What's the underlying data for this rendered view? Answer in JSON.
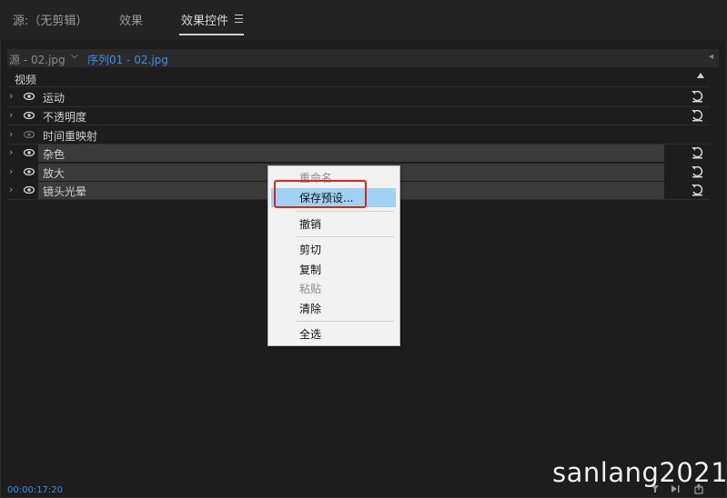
{
  "tabs": [
    {
      "label": "源:（无剪辑）",
      "active": false
    },
    {
      "label": "效果",
      "active": false
    },
    {
      "label": "效果控件",
      "active": true
    }
  ],
  "source_bar": {
    "source": "源 - 02.jpg",
    "sequence": "序列01 - 02.jpg"
  },
  "section": {
    "title": "视频"
  },
  "effects": [
    {
      "label": "运动",
      "icon": "eye-icon",
      "has_reset": true,
      "selected": false
    },
    {
      "label": "不透明度",
      "icon": "eye-icon",
      "has_reset": true,
      "selected": false
    },
    {
      "label": "时间重映射",
      "icon": "eye-icon",
      "has_reset": false,
      "selected": false
    },
    {
      "label": "杂色",
      "icon": "eye-icon",
      "has_reset": true,
      "selected": true
    },
    {
      "label": "放大",
      "icon": "eye-icon",
      "has_reset": true,
      "selected": true
    },
    {
      "label": "镜头光晕",
      "icon": "eye-icon",
      "has_reset": true,
      "selected": true
    }
  ],
  "context_menu": {
    "items": [
      {
        "label": "重命名",
        "disabled": true
      },
      {
        "label": "保存预设...",
        "disabled": false,
        "highlighted": true
      },
      {
        "label": "撤销",
        "disabled": false
      },
      {
        "label": "剪切",
        "disabled": false
      },
      {
        "label": "复制",
        "disabled": false
      },
      {
        "label": "粘贴",
        "disabled": true
      },
      {
        "label": "清除",
        "disabled": false
      },
      {
        "label": "全选",
        "disabled": false
      }
    ]
  },
  "timecode": "00:00:17:20",
  "watermark": "sanlang2021",
  "colors": {
    "accent_blue": "#3d8fe0",
    "menu_highlight": "#9fd2f5",
    "annotation_red": "#e0241b"
  }
}
